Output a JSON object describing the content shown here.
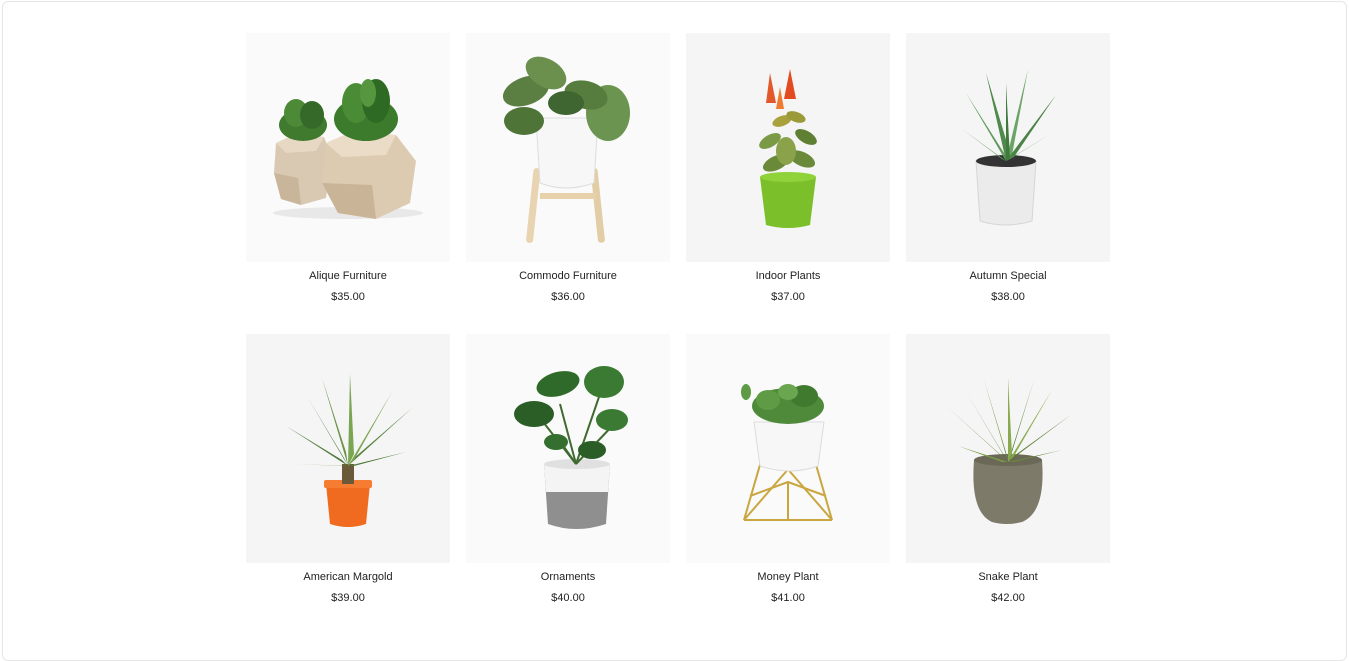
{
  "products": [
    {
      "name": "Alique Furniture",
      "price": "$35.00",
      "icon": "wooden-planters-icon"
    },
    {
      "name": "Commodo Furniture",
      "price": "$36.00",
      "icon": "plant-on-stand-icon"
    },
    {
      "name": "Indoor Plants",
      "price": "$37.00",
      "icon": "green-pot-plant-icon"
    },
    {
      "name": "Autumn Special",
      "price": "$38.00",
      "icon": "aloe-plant-icon"
    },
    {
      "name": "American Margold",
      "price": "$39.00",
      "icon": "orange-pot-agave-icon"
    },
    {
      "name": "Ornaments",
      "price": "$40.00",
      "icon": "monstera-plant-icon"
    },
    {
      "name": "Money Plant",
      "price": "$41.00",
      "icon": "gold-stand-plant-icon"
    },
    {
      "name": "Snake Plant",
      "price": "$42.00",
      "icon": "stone-pot-agave-icon"
    }
  ],
  "colors": {
    "tile_background": "#f5f5f5",
    "text": "#222222"
  }
}
